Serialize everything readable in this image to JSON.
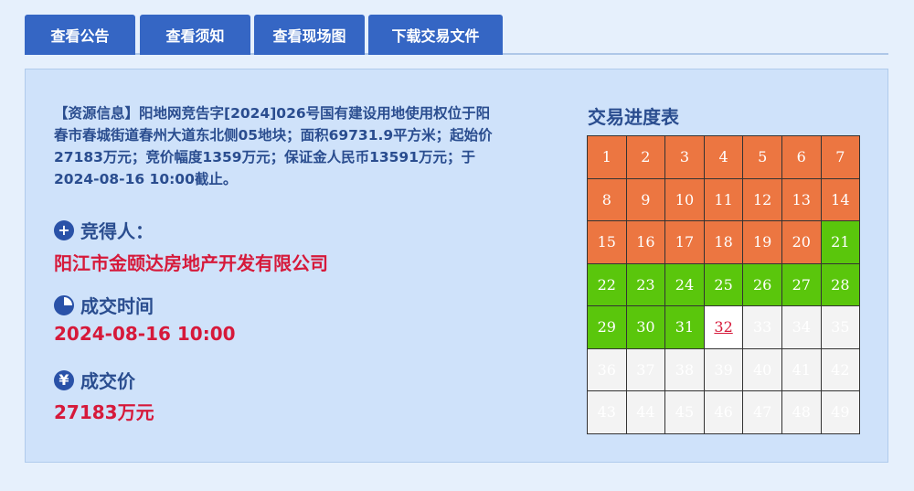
{
  "tabs": [
    {
      "label": "查看公告"
    },
    {
      "label": "查看须知"
    },
    {
      "label": "查看现场图"
    },
    {
      "label": "下载交易文件"
    }
  ],
  "resource_info": "【资源信息】阳地网竞告字[2024]026号国有建设用地使用权位于阳春市春城街道春州大道东北侧05地块；面积69731.9平方米；起始价27183万元；竞价幅度1359万元；保证金人民币13591万元；于2024-08-16 10:00截止。",
  "winner": {
    "label": "竞得人：",
    "value": "阳江市金颐达房地产开发有限公司",
    "icon": "plus-circle-icon"
  },
  "deal_time": {
    "label": "成交时间",
    "value": "2024-08-16 10:00",
    "icon": "clock-icon"
  },
  "deal_price": {
    "label": "成交价",
    "value": "27183万元",
    "icon": "yen-icon"
  },
  "progress": {
    "title": "交易进度表",
    "total": 49,
    "rows": [
      [
        "1",
        "2",
        "3",
        "4",
        "5",
        "6",
        "7"
      ],
      [
        "8",
        "9",
        "10",
        "11",
        "12",
        "13",
        "14"
      ],
      [
        "15",
        "16",
        "17",
        "18",
        "19",
        "20",
        "21"
      ],
      [
        "22",
        "23",
        "24",
        "25",
        "26",
        "27",
        "28"
      ],
      [
        "29",
        "30",
        "31",
        "32",
        "33",
        "34",
        "35"
      ],
      [
        "36",
        "37",
        "38",
        "39",
        "40",
        "41",
        "42"
      ],
      [
        "43",
        "44",
        "45",
        "46",
        "47",
        "48",
        "49"
      ]
    ],
    "orange_up_to": 20,
    "green_up_to": 31,
    "current": 32,
    "colors": {
      "orange": "#ec7641",
      "green": "#5ac60c",
      "current_text": "#d6193a",
      "pending": "#f3f3f3"
    }
  }
}
